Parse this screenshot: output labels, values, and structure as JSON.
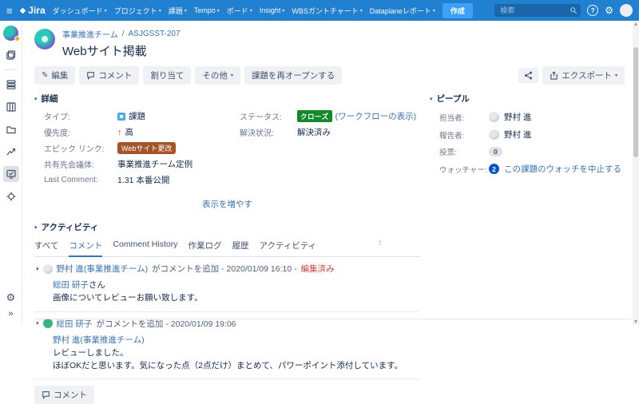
{
  "colors": {
    "navbar_bg": "#2280D1",
    "create_button_bg": "#3FA0F8",
    "link_blue": "#3B73AF",
    "status_green": "#14892C",
    "epic_badge_brown": "#A5542A",
    "edited_red": "#D04437",
    "watcher_badge_blue": "#0052CC",
    "comment_avatar_green": "#36B37E"
  },
  "icons": {
    "hamburger": "≡",
    "caret_down": "▾",
    "collapse": "▾",
    "help": "?",
    "gear": "⚙",
    "expand": "»",
    "pencil": "✎",
    "priority_high": "↑",
    "scroll_top": "↑"
  },
  "navbar": {
    "logo_mark": "◆",
    "logo_text": "Jira",
    "menu": [
      "ダッシュボード",
      "プロジェクト",
      "課題",
      "Tempo",
      "ボード",
      "Insight",
      "WBSガントチャート",
      "Dataplaneレポート"
    ],
    "create_label": "作成",
    "search_placeholder": "検索"
  },
  "header": {
    "breadcrumb_project": "事業推進チーム",
    "breadcrumb_sep": "/",
    "issue_key": "ASJGSST-207",
    "title": "Webサイト掲載",
    "edit_label": "編集",
    "comment_label": "コメント",
    "assign_label": "割り当て",
    "more_label": "その他",
    "reopen_label": "課題を再オープンする",
    "export_label": "エクスポート"
  },
  "details": {
    "title": "詳細",
    "type_label": "タイプ:",
    "type_value": "課題",
    "priority_label": "優先度:",
    "priority_value": "高",
    "epic_label": "エピック リンク:",
    "epic_value": "Webサイト更改",
    "meeting_label": "共有先会議体:",
    "meeting_value": "事業推進チーム定例",
    "last_comment_label": "Last Comment:",
    "last_comment_value": "1.31 本番公開",
    "status_label": "ステータス:",
    "status_value": "クローズ",
    "workflow_link": "(ワークフローの表示)",
    "resolution_label": "解決状況:",
    "resolution_value": "解決済み",
    "show_more": "表示を増やす"
  },
  "people": {
    "title": "ピープル",
    "assignee_label": "担当者:",
    "assignee": "野村 進",
    "reporter_label": "報告者:",
    "reporter": "野村 進",
    "votes_label": "投票:",
    "votes": "0",
    "watchers_label": "ウォッチャー:",
    "watchers": "2",
    "watch_link": "この課題のウォッチを中止する"
  },
  "activity": {
    "title": "アクティビティ",
    "tabs": [
      "すべて",
      "コメント",
      "Comment History",
      "作業ログ",
      "履歴",
      "アクティビティ"
    ],
    "active_tab": "コメント",
    "comments": [
      {
        "author": "野村 進(事業推進チーム)",
        "meta": "がコメントを追加 - 2020/01/09 16:10 -",
        "edited": "編集済み",
        "body_link": "総田 研子",
        "body_link_suffix": "さん",
        "body_lines": [
          "画像についてレビューお願い致します。"
        ]
      },
      {
        "author": "総田 研子",
        "meta": "がコメントを追加 - 2020/01/09 19:06",
        "body_link": "野村 進(事業推進チーム)",
        "body_link_suffix": "",
        "body_lines": [
          "レビューしました。",
          "ほぼOKだと思います。気になった点（2点だけ）まとめて、パワーポイント添付しています。"
        ]
      }
    ],
    "comment_button": "コメント"
  }
}
